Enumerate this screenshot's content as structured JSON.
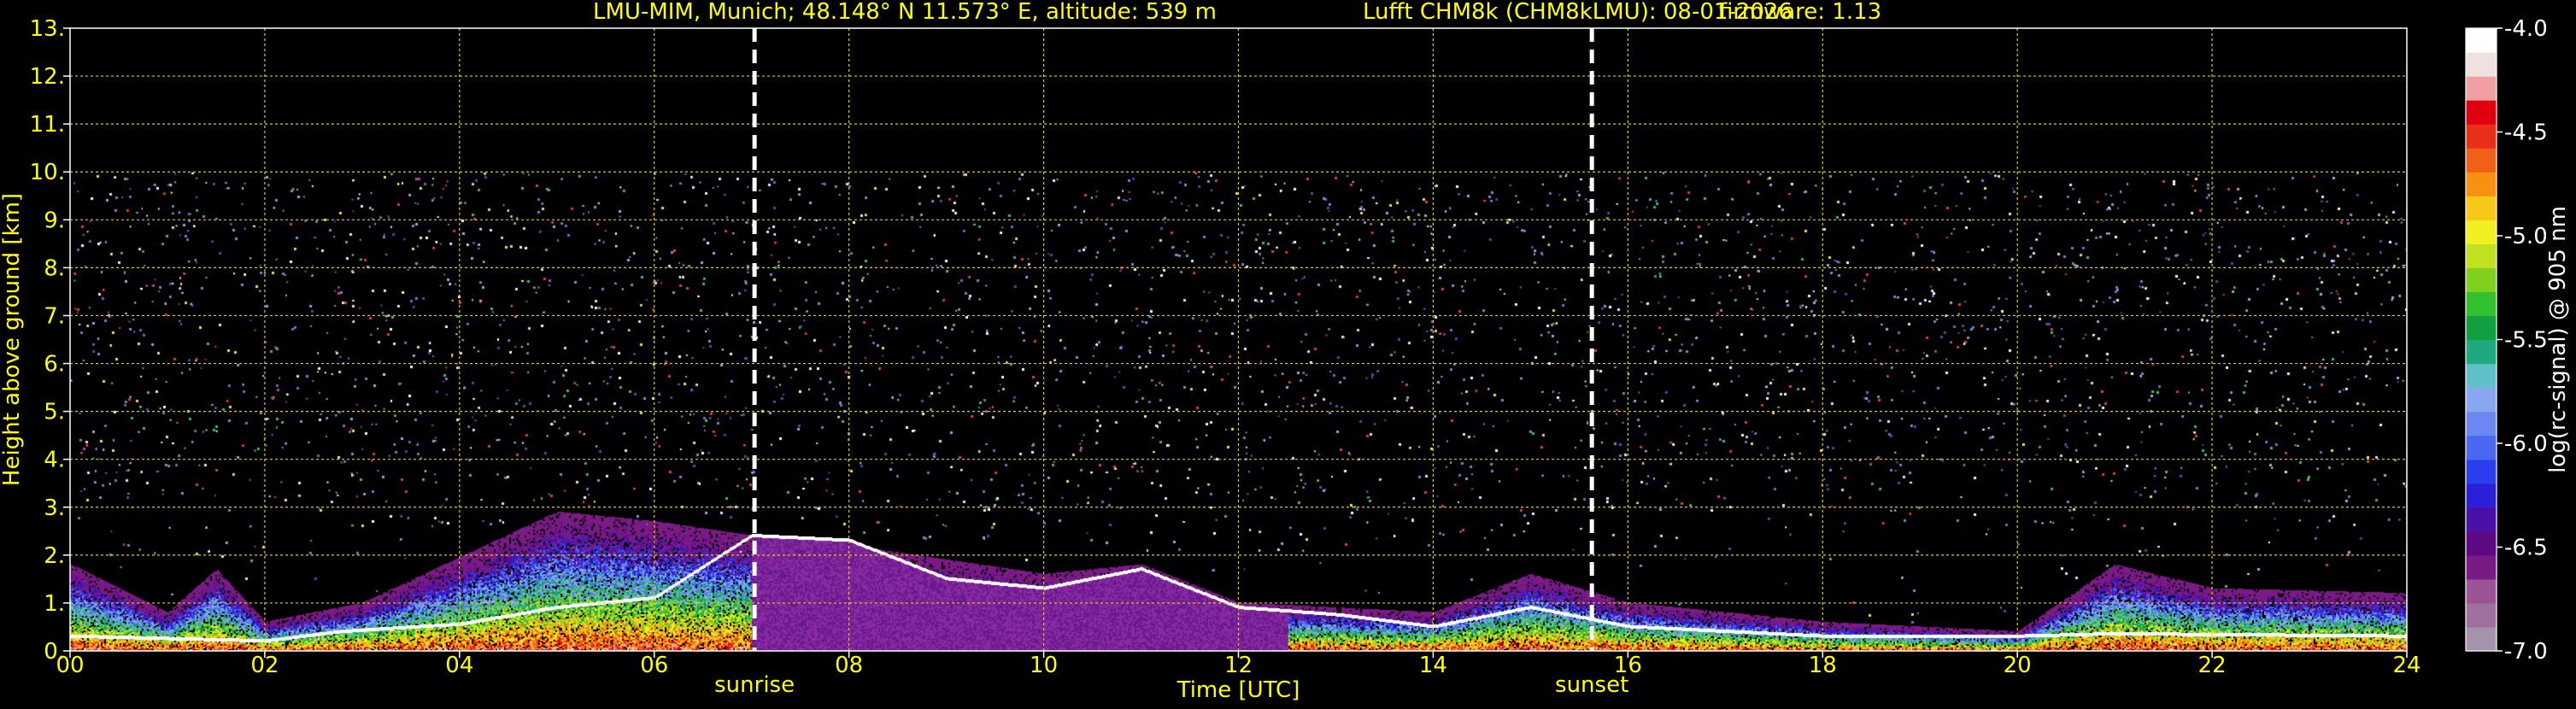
{
  "header": {
    "station": "LMU-MIM, Munich; 48.148° N 11.573° E, altitude: 539 m",
    "instrument": "Lufft CHM8k (CHM8kLMU): 08-01-2026",
    "firmware": "firmware: 1.13"
  },
  "chart_data": {
    "type": "heatmap",
    "title": "LMU-MIM, Munich; 48.148° N 11.573° E, altitude: 539 m    Lufft CHM8k (CHM8kLMU): 08-01-2026    firmware: 1.13",
    "xlabel": "Time [UTC]",
    "ylabel": "Height above ground [km]",
    "xlim": [
      0,
      24
    ],
    "ylim": [
      0,
      13
    ],
    "x_ticks": [
      0,
      2,
      4,
      6,
      8,
      10,
      12,
      14,
      16,
      18,
      20,
      22,
      24
    ],
    "x_tick_labels": [
      "00",
      "02",
      "04",
      "06",
      "08",
      "10",
      "12",
      "14",
      "16",
      "18",
      "20",
      "22",
      "24"
    ],
    "y_ticks": [
      0,
      1,
      2,
      3,
      4,
      5,
      6,
      7,
      8,
      9,
      10,
      11,
      12,
      13
    ],
    "y_tick_labels": [
      "0.",
      "1.",
      "2.",
      "3.",
      "4.",
      "5.",
      "6.",
      "7.",
      "8.",
      "9.",
      "10.",
      "11.",
      "12.",
      "13."
    ],
    "grid": true,
    "data_ceiling_km": 10,
    "markers": [
      {
        "label": "sunrise",
        "x": 7.03
      },
      {
        "label": "sunset",
        "x": 15.63
      }
    ],
    "colorbar": {
      "label": "log(rc-signal) @ 905 nm",
      "range": [
        -7.0,
        -4.0
      ],
      "ticks": [
        -4.0,
        -4.5,
        -5.0,
        -5.5,
        -6.0,
        -6.5,
        -7.0
      ],
      "tick_labels": [
        "-4.0",
        "-4.5",
        "-5.0",
        "-5.5",
        "-6.0",
        "-6.5",
        "-7.0"
      ],
      "colors": [
        "#a592ad",
        "#a0719f",
        "#9c5496",
        "#7a1a84",
        "#5d0a84",
        "#4a10a8",
        "#2a20d8",
        "#2a40f0",
        "#4a68f0",
        "#6a88f0",
        "#8aa6f0",
        "#60c0c8",
        "#20a880",
        "#10a040",
        "#30c030",
        "#80d020",
        "#c0e020",
        "#f0f020",
        "#f8c818",
        "#f89010",
        "#f06018",
        "#e83018",
        "#e00010",
        "#f0a0a0",
        "#f0e0e0",
        "#ffffff"
      ]
    },
    "cloud_base_km": [
      {
        "x": 0.0,
        "base": 0.3
      },
      {
        "x": 2.0,
        "base": 0.2
      },
      {
        "x": 2.8,
        "base": 0.4
      },
      {
        "x": 4.0,
        "base": 0.55
      },
      {
        "x": 5.0,
        "base": 0.9
      },
      {
        "x": 6.0,
        "base": 1.1
      },
      {
        "x": 7.0,
        "base": 2.4
      },
      {
        "x": 8.0,
        "base": 2.3
      },
      {
        "x": 9.0,
        "base": 1.5
      },
      {
        "x": 10.0,
        "base": 1.3
      },
      {
        "x": 11.0,
        "base": 1.7
      },
      {
        "x": 12.0,
        "base": 0.9
      },
      {
        "x": 13.0,
        "base": 0.75
      },
      {
        "x": 14.0,
        "base": 0.5
      },
      {
        "x": 15.0,
        "base": 0.9
      },
      {
        "x": 16.0,
        "base": 0.5
      },
      {
        "x": 18.0,
        "base": 0.3
      },
      {
        "x": 20.0,
        "base": 0.3
      },
      {
        "x": 21.0,
        "base": 0.35
      },
      {
        "x": 24.0,
        "base": 0.3
      }
    ],
    "aerosol_layer_top_km": [
      {
        "x": 0.0,
        "top": 1.8
      },
      {
        "x": 1.0,
        "top": 0.8
      },
      {
        "x": 1.5,
        "top": 1.7
      },
      {
        "x": 2.0,
        "top": 0.6
      },
      {
        "x": 3.0,
        "top": 1.0
      },
      {
        "x": 5.0,
        "top": 2.9
      },
      {
        "x": 6.0,
        "top": 2.7
      },
      {
        "x": 7.0,
        "top": 2.4
      },
      {
        "x": 8.0,
        "top": 2.2
      },
      {
        "x": 9.0,
        "top": 1.9
      },
      {
        "x": 10.0,
        "top": 1.6
      },
      {
        "x": 11.0,
        "top": 1.8
      },
      {
        "x": 12.0,
        "top": 1.0
      },
      {
        "x": 14.0,
        "top": 0.8
      },
      {
        "x": 15.0,
        "top": 1.6
      },
      {
        "x": 16.0,
        "top": 1.0
      },
      {
        "x": 18.0,
        "top": 0.6
      },
      {
        "x": 20.0,
        "top": 0.4
      },
      {
        "x": 21.0,
        "top": 1.8
      },
      {
        "x": 22.0,
        "top": 1.3
      },
      {
        "x": 24.0,
        "top": 1.2
      }
    ]
  }
}
